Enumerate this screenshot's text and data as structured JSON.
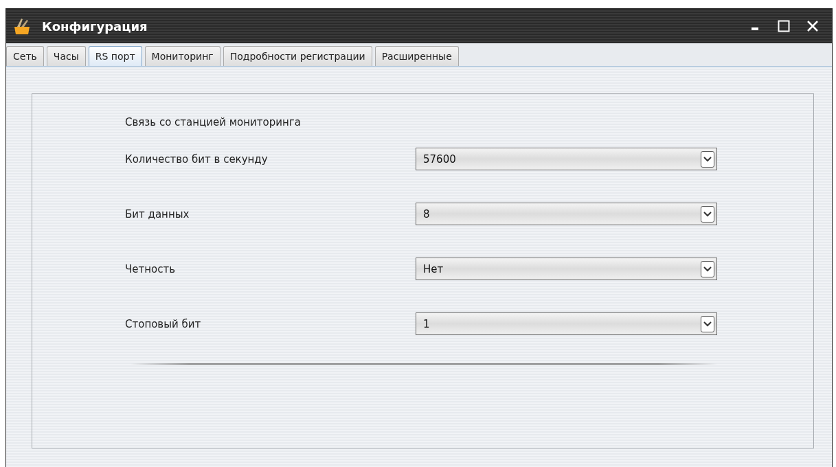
{
  "window": {
    "title": "Конфигурация"
  },
  "tabs": [
    {
      "label": "Сеть",
      "selected": false
    },
    {
      "label": "Часы",
      "selected": false
    },
    {
      "label": "RS порт",
      "selected": true
    },
    {
      "label": "Мониторинг",
      "selected": false
    },
    {
      "label": "Подробности регистрации",
      "selected": false
    },
    {
      "label": "Расширенные",
      "selected": false
    }
  ],
  "section_title": "Связь со станцией мониторинга",
  "settings": [
    {
      "label": "Количество бит в секунду",
      "value": "57600"
    },
    {
      "label": "Бит данных",
      "value": "8"
    },
    {
      "label": "Четность",
      "value": "Нет"
    },
    {
      "label": "Стоповый бит",
      "value": "1"
    }
  ]
}
